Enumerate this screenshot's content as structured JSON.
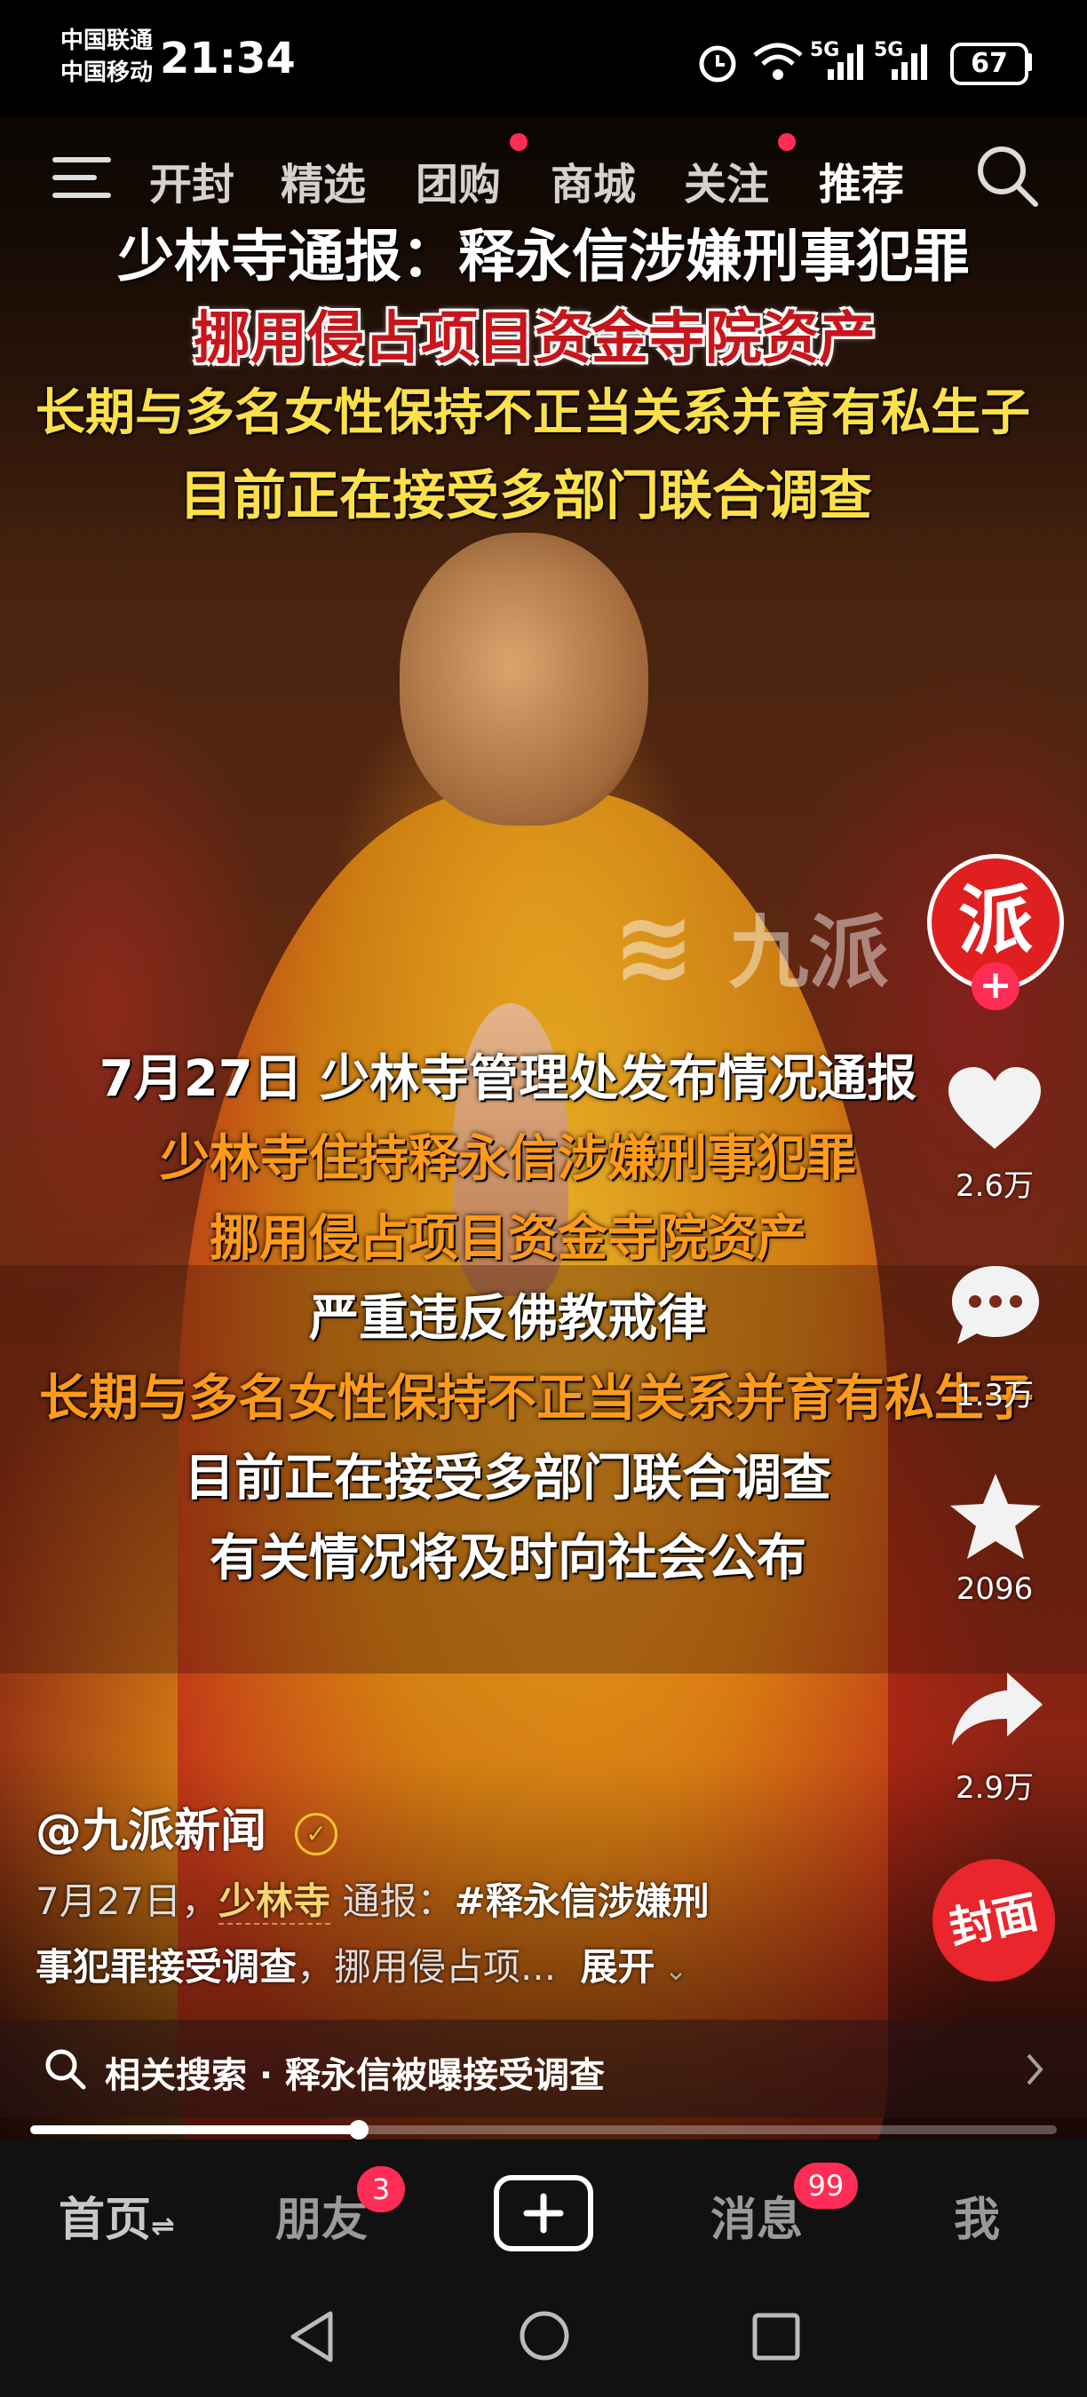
{
  "status_bar": {
    "carrier_1": "中国联通",
    "carrier_2": "中国移动",
    "time": "21:34",
    "network_1": "5G",
    "network_2": "5G",
    "battery": "67"
  },
  "top_nav": {
    "tabs": [
      {
        "label": "开封",
        "dot": false
      },
      {
        "label": "精选",
        "dot": false
      },
      {
        "label": "团购",
        "dot": true
      },
      {
        "label": "商城",
        "dot": false
      },
      {
        "label": "关注",
        "dot": true
      },
      {
        "label": "推荐",
        "dot": false
      }
    ]
  },
  "video": {
    "headline": [
      "少林寺通报：释永信涉嫌刑事犯罪",
      "挪用侵占项目资金寺院资产",
      "长期与多名女性保持不正当关系并育有私生子",
      "目前正在接受多部门联合调查"
    ],
    "caption": [
      "7月27日  少林寺管理处发布情况通报",
      "少林寺住持释永信涉嫌刑事犯罪",
      "挪用侵占项目资金寺院资产",
      "严重违反佛教戒律",
      "长期与多名女性保持不正当关系并育有私生子",
      "目前正在接受多部门联合调查",
      "有关情况将及时向社会公布"
    ],
    "watermark": "九派"
  },
  "side_actions": {
    "avatar_label": "派",
    "like_count": "2.6万",
    "comment_count": "1.3万",
    "favorite_count": "2096",
    "share_count": "2.9万",
    "cover_label": "封面"
  },
  "post": {
    "author": "@九派新闻",
    "desc_date": "7月27日，",
    "desc_link": "少林寺",
    "desc_text": "通报：",
    "desc_tag": "#释永信涉嫌刑",
    "desc_line2": "事犯罪接受调查",
    "desc_rest": "，挪用侵占项...",
    "expand": "展开"
  },
  "related_search": {
    "label": "相关搜索 · 释永信被曝接受调查"
  },
  "progress": {
    "fraction": 0.32
  },
  "bottom_nav": {
    "home": "首页",
    "friends": "朋友",
    "friends_badge": "3",
    "messages": "消息",
    "messages_badge": "99",
    "me": "我"
  },
  "colors": {
    "accent": "#ff2d55",
    "headline_yellow": "#ffe04a",
    "caption_orange": "#ff9a1a",
    "headline_red": "#c7161b",
    "avatar_red": "#e02020"
  }
}
